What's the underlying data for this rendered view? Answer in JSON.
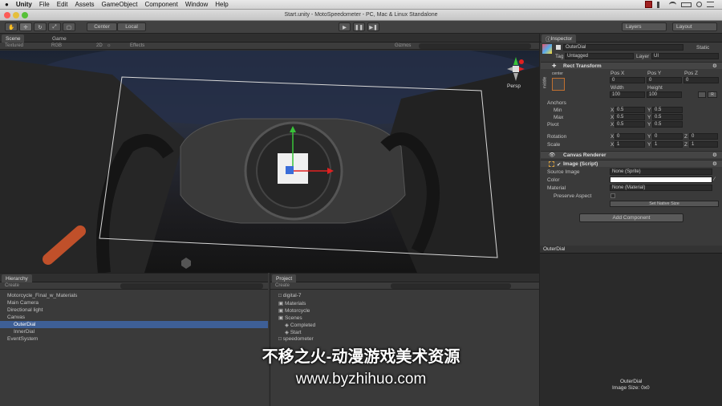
{
  "menubar": {
    "apple": "",
    "app": "Unity",
    "items": [
      "File",
      "Edit",
      "Assets",
      "GameObject",
      "Component",
      "Window",
      "Help"
    ]
  },
  "window_title": "Start.unity - MotoSpeedometer - PC, Mac & Linux Standalone",
  "toolbar": {
    "pivot": "Center",
    "space": "Local",
    "layers": "Layers",
    "layout": "Layout"
  },
  "scene": {
    "tab_scene": "Scene",
    "tab_game": "Game",
    "shading": "Textured",
    "render": "RGB",
    "mode2d": "2D",
    "effects": "Effects",
    "gizmos": "Gizmos",
    "gizmo_label": "Persp"
  },
  "hierarchy": {
    "tab": "Hierarchy",
    "create": "Create",
    "items": [
      "Motorcycle_Final_w_Materials",
      "Main Camera",
      "Directional light",
      "Canvas",
      "OuterDial",
      "InnerDial",
      "EventSystem"
    ]
  },
  "project": {
    "tab": "Project",
    "create": "Create",
    "items": [
      "digital-7",
      "Materials",
      "Motorcycle",
      "Scenes",
      "Completed",
      "Start",
      "speedometer"
    ]
  },
  "inspector": {
    "tab": "Inspector",
    "object_name": "OuterDial",
    "static": "Static",
    "tag_label": "Tag",
    "tag_value": "Untagged",
    "layer_label": "Layer",
    "layer_value": "UI",
    "rect_transform": "Rect Transform",
    "center": "center",
    "middle": "middle",
    "posx": "Pos X",
    "posy": "Pos Y",
    "posz": "Pos Z",
    "posx_val": "0",
    "posy_val": "0",
    "posz_val": "0",
    "width": "Width",
    "height": "Height",
    "width_val": "100",
    "height_val": "100",
    "anchors": "Anchors",
    "min": "Min",
    "max": "Max",
    "pivot": "Pivot",
    "min_x": "0.5",
    "min_y": "0.5",
    "max_x": "0.5",
    "max_y": "0.5",
    "pivot_x": "0.5",
    "pivot_y": "0.5",
    "rotation": "Rotation",
    "scale": "Scale",
    "rot_x": "0",
    "rot_y": "0",
    "rot_z": "0",
    "scale_x": "1",
    "scale_y": "1",
    "scale_z": "1",
    "x": "X",
    "y": "Y",
    "z": "Z",
    "r_btn": "R",
    "canvas_renderer": "Canvas Renderer",
    "image_script": "Image (Script)",
    "source_image": "Source Image",
    "source_value": "None (Sprite)",
    "color": "Color",
    "material": "Material",
    "material_value": "None (Material)",
    "preserve_aspect": "Preserve Aspect",
    "native_size": "Set Native Size",
    "add_component": "Add Component"
  },
  "preview": {
    "title": "OuterDial",
    "name": "OuterDial",
    "size": "Image Size: 0x0"
  },
  "watermark": {
    "line1": "不移之火-动漫游戏美术资源",
    "line2": "www.byzhihuo.com"
  },
  "colors": {
    "selection": "#3e5f96",
    "accent_red": "#e02020",
    "accent_green": "#39c239"
  }
}
